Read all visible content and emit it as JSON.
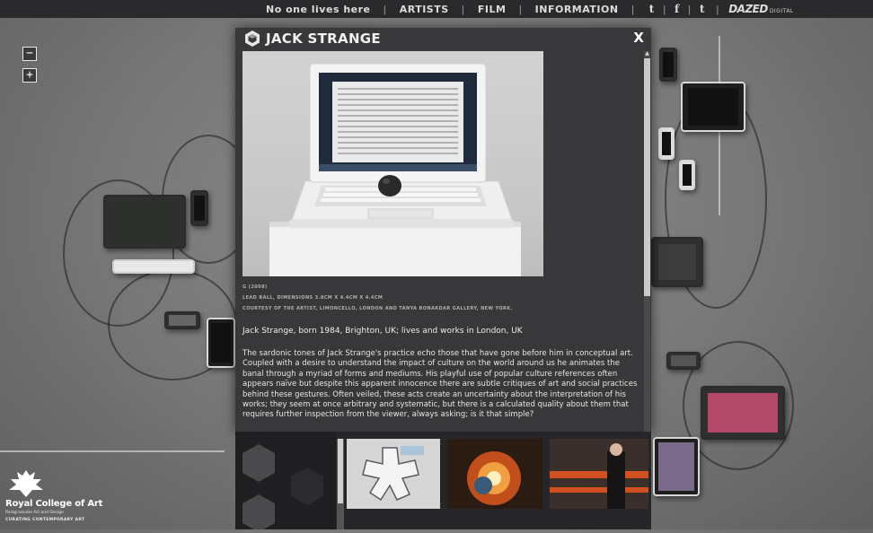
{
  "nav": {
    "tagline": "No one lives here",
    "links": [
      "ARTISTS",
      "FILM",
      "INFORMATION"
    ],
    "social": [
      "t",
      "f",
      "t"
    ],
    "brand": "DAZED",
    "brand_sub": "DIGITAL"
  },
  "zoom": {
    "minus": "−",
    "plus": "+"
  },
  "modal": {
    "title": "JACK STRANGE",
    "close": "X",
    "caption_title": "G (2008)",
    "caption_medium": "LEAD BALL, DIMENSIONS 3.8CM X 4.4CM X 4.4CM",
    "caption_courtesy": "COURTESY OF THE ARTIST, LIMONCELLO, LONDON AND TANYA BONAKDAR GALLERY, NEW YORK.",
    "bio": "Jack Strange, born 1984, Brighton, UK; lives and works in London, UK",
    "description": "The sardonic tones of Jack Strange's practice echo those that have gone before him in conceptual art. Coupled with a desire to understand the impact of culture on the world around us he animates the banal through a myriad of forms and mediums. His playful use of popular culture references often appears naïve but despite this apparent innocence there are subtle critiques of art and social practices behind these gestures. Often veiled, these acts create an uncertainty about the interpretation of his works; they seem at once arbitrary and systematic, but there is a calculated quality about them that requires further inspection from the viewer, always asking; is it that simple?"
  },
  "footer_logo": {
    "name": "Royal College of Art",
    "sub": "Postgraduate Art and Design",
    "dept": "CURATING CONTEMPORARY ART"
  },
  "colors": {
    "nav_bg": "#2a2a2c",
    "modal_bg": "#38383b",
    "text": "#eeeeee"
  }
}
